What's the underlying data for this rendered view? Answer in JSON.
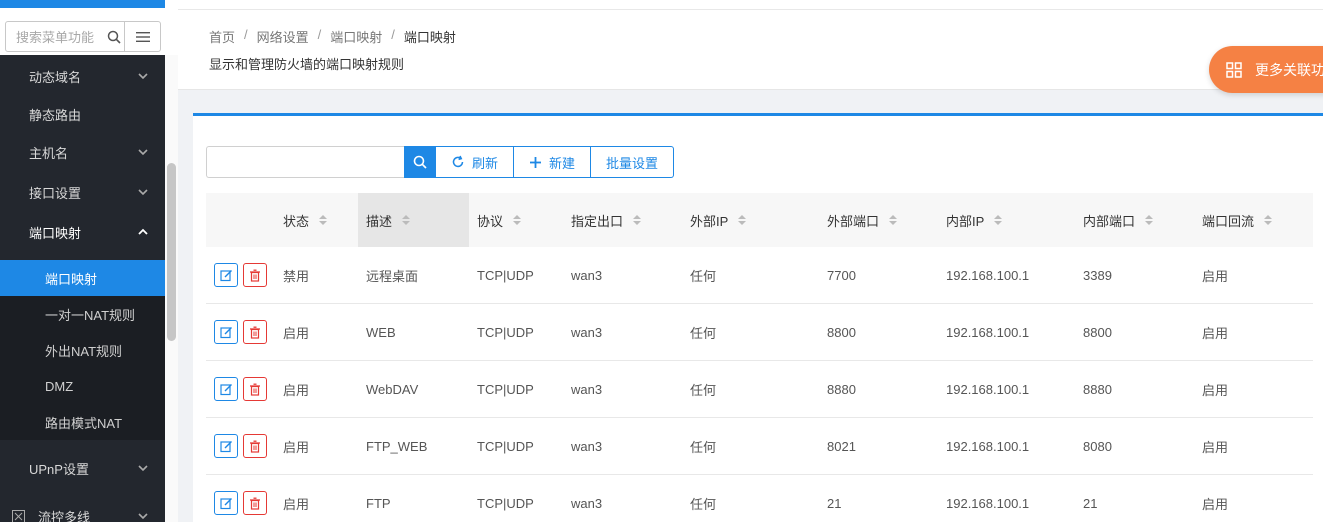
{
  "sidebar": {
    "search_placeholder": "搜索菜单功能",
    "items": [
      {
        "label": "动态域名"
      },
      {
        "label": "静态路由"
      },
      {
        "label": "主机名"
      },
      {
        "label": "接口设置"
      },
      {
        "label": "端口映射"
      },
      {
        "label": "UPnP设置"
      },
      {
        "label": "流控多线"
      }
    ],
    "sub_items": [
      {
        "label": "端口映射",
        "active": true
      },
      {
        "label": "一对一NAT规则"
      },
      {
        "label": "外出NAT规则"
      },
      {
        "label": "DMZ"
      },
      {
        "label": "路由模式NAT"
      }
    ]
  },
  "breadcrumb": [
    "首页",
    "网络设置",
    "端口映射",
    "端口映射"
  ],
  "page_description": "显示和管理防火墙的端口映射规则",
  "more_button": "更多关联功能",
  "toolbar": {
    "refresh": "刷新",
    "new": "新建",
    "batch": "批量设置"
  },
  "table": {
    "columns": [
      "状态",
      "描述",
      "协议",
      "指定出口",
      "外部IP",
      "外部端口",
      "内部IP",
      "内部端口",
      "端口回流"
    ],
    "rows": [
      [
        "禁用",
        "远程桌面",
        "TCP|UDP",
        "wan3",
        "任何",
        "7700",
        "192.168.100.1",
        "3389",
        "启用"
      ],
      [
        "启用",
        "WEB",
        "TCP|UDP",
        "wan3",
        "任何",
        "8800",
        "192.168.100.1",
        "8800",
        "启用"
      ],
      [
        "启用",
        "WebDAV",
        "TCP|UDP",
        "wan3",
        "任何",
        "8880",
        "192.168.100.1",
        "8880",
        "启用"
      ],
      [
        "启用",
        "FTP_WEB",
        "TCP|UDP",
        "wan3",
        "任何",
        "8021",
        "192.168.100.1",
        "8080",
        "启用"
      ],
      [
        "启用",
        "FTP",
        "TCP|UDP",
        "wan3",
        "任何",
        "21",
        "192.168.100.1",
        "21",
        "启用"
      ]
    ]
  },
  "colors": {
    "primary": "#1e88e5",
    "danger": "#e53935",
    "sidebar_bg": "#23272e",
    "accent_orange": "#f58144"
  }
}
